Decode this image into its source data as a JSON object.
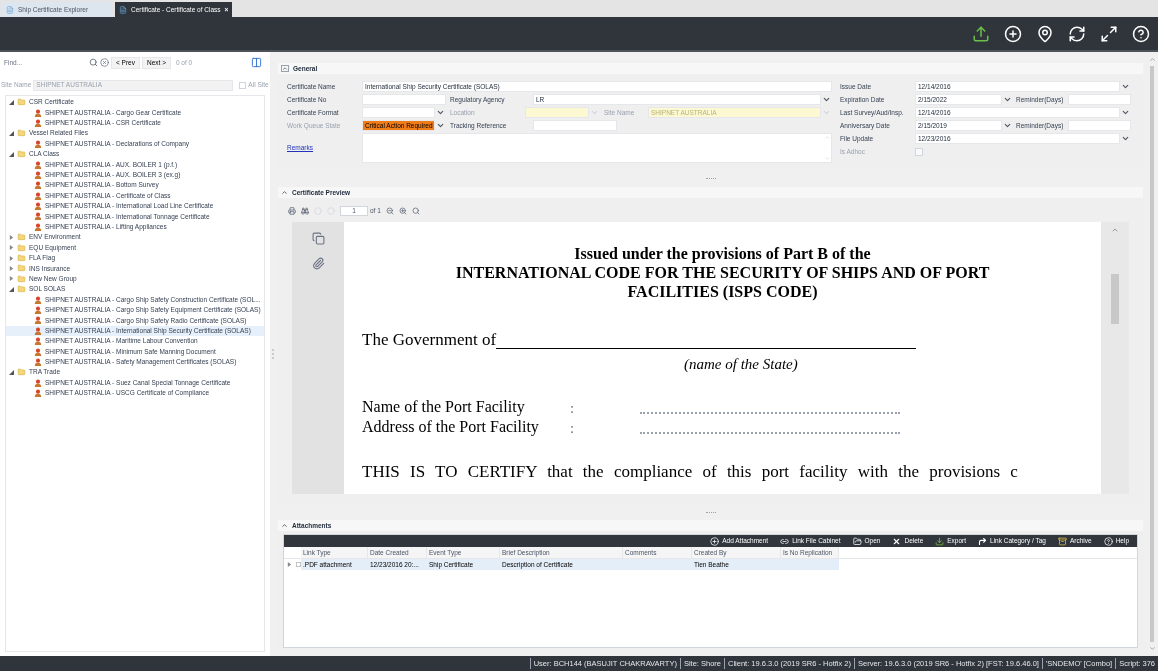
{
  "tabs": [
    {
      "label": "Ship Certificate Explorer",
      "selected": false
    },
    {
      "label": "Certificate - Certificate of Class",
      "selected": true,
      "close": "×"
    }
  ],
  "finder": {
    "placeholder": "Find...",
    "prev": "< Prev",
    "next": "Next >",
    "count": "0 of 0"
  },
  "site": {
    "label": "Site Name",
    "value": "SHIPNET AUSTRALIA",
    "all_label": "All Site",
    "all_checked": false
  },
  "tree": [
    {
      "label": "CSR Certificate",
      "expanded": true,
      "children": [
        {
          "label": "SHIPNET AUSTRALIA - Cargo Gear Certificate",
          "selected": false
        },
        {
          "label": "SHIPNET AUSTRALIA - CSR Certificate",
          "selected": false
        }
      ]
    },
    {
      "label": "Vessel Related Files",
      "expanded": true,
      "children": [
        {
          "label": "SHIPNET AUSTRALIA -  Declarations of Company",
          "selected": false
        }
      ]
    },
    {
      "label": "CLA Class",
      "expanded": true,
      "children": [
        {
          "label": "SHIPNET AUSTRALIA - AUX. BOILER 1 (p.f.)",
          "selected": false
        },
        {
          "label": "SHIPNET AUSTRALIA - AUX. BOILER 3 (ex.g)",
          "selected": false
        },
        {
          "label": "SHIPNET AUSTRALIA - Bottom Survey",
          "selected": false
        },
        {
          "label": "SHIPNET AUSTRALIA - Certificate of Class",
          "selected": false
        },
        {
          "label": "SHIPNET AUSTRALIA - International Load Line Certificate",
          "selected": false
        },
        {
          "label": "SHIPNET AUSTRALIA - International Tonnage Certificate",
          "selected": false
        },
        {
          "label": "SHIPNET AUSTRALIA - Lifting Appliances",
          "selected": false
        }
      ]
    },
    {
      "label": "ENV Environment",
      "expanded": false
    },
    {
      "label": "EQU Equipment",
      "expanded": false
    },
    {
      "label": "FLA Flag",
      "expanded": false
    },
    {
      "label": "INS Insurance",
      "expanded": false
    },
    {
      "label": "New New Group",
      "expanded": false
    },
    {
      "label": "SOL SOLAS",
      "expanded": true,
      "children": [
        {
          "label": "SHIPNET AUSTRALIA - Cargo Ship Safety Construction Certificate (SOL...",
          "selected": false
        },
        {
          "label": "SHIPNET AUSTRALIA - Cargo Ship Safety Equipment Certificate (SOLAS)",
          "selected": false
        },
        {
          "label": "SHIPNET AUSTRALIA - Cargo Ship Safety Radio Certificate (SOLAS)",
          "selected": false
        },
        {
          "label": "SHIPNET AUSTRALIA - International Ship Security Certificate (SOLAS)",
          "selected": true
        },
        {
          "label": "SHIPNET AUSTRALIA - Maritime Labour Convention",
          "selected": false
        },
        {
          "label": "SHIPNET AUSTRALIA - Minimum Safe Manning Document",
          "selected": false
        },
        {
          "label": "SHIPNET AUSTRALIA - Safety Management Certificates (SOLAS)",
          "selected": false
        }
      ]
    },
    {
      "label": "TRA Trade",
      "expanded": true,
      "children": [
        {
          "label": "SHIPNET AUSTRALIA - Suez Canal Special Tonnage Certificate",
          "selected": false
        },
        {
          "label": "SHIPNET AUSTRALIA - USCG Certificate of Compliance",
          "selected": false
        }
      ]
    }
  ],
  "general": {
    "title": "General",
    "left_rows": [
      [
        {
          "kind": "label",
          "text": "Certificate Name",
          "disabled": false
        },
        {
          "kind": "text",
          "value": "International Ship Security Certificate (SOLAS)",
          "disabled": false,
          "alert": false
        }
      ],
      [
        {
          "kind": "label",
          "text": "Certificate No",
          "disabled": false
        },
        {
          "kind": "text",
          "disabled": false,
          "alert": false
        },
        {
          "kind": "label",
          "text": "Regulatory Agency",
          "disabled": false
        },
        {
          "kind": "select",
          "value": "LR",
          "disabled": false,
          "alert": false
        }
      ],
      [
        {
          "kind": "label",
          "text": "Certificate Format",
          "disabled": false
        },
        {
          "kind": "select",
          "disabled": false,
          "alert": false
        },
        {
          "kind": "label",
          "text": "Location",
          "disabled": true
        },
        {
          "kind": "select",
          "disabled": true,
          "alert": false
        },
        {
          "kind": "label",
          "text": "Site Name",
          "disabled": true
        },
        {
          "kind": "select",
          "value": "SHIPNET AUSTRALIA",
          "disabled": true,
          "alert": false
        }
      ],
      [
        {
          "kind": "label",
          "text": "Work Queue State",
          "disabled": true
        },
        {
          "kind": "select",
          "value": "Critical Action Required",
          "disabled": false,
          "alert": true
        },
        {
          "kind": "label",
          "text": "Tracking Reference",
          "disabled": false
        },
        {
          "kind": "text",
          "disabled": false,
          "alert": false
        }
      ],
      [
        {
          "kind": "link",
          "text": "Remarks"
        },
        {
          "kind": "memo",
          "disabled": false,
          "alert": false
        }
      ]
    ],
    "right_rows": [
      [
        {
          "kind": "label",
          "text": "Issue Date",
          "disabled": false
        },
        {
          "kind": "select",
          "value": "12/14/2016",
          "disabled": false,
          "alert": false
        }
      ],
      [
        {
          "kind": "label",
          "text": "Expiration Date",
          "disabled": false
        },
        {
          "kind": "select",
          "value": "2/15/2022",
          "disabled": false,
          "alert": false
        },
        {
          "kind": "label",
          "text": "Reminder(Days)",
          "disabled": false
        },
        {
          "kind": "text",
          "disabled": false,
          "alert": false
        }
      ],
      [
        {
          "kind": "label",
          "text": "Last Survey/Aud/Insp.",
          "disabled": false
        },
        {
          "kind": "select",
          "value": "12/14/2016",
          "disabled": false,
          "alert": false
        }
      ],
      [
        {
          "kind": "label",
          "text": "Anniversary Date",
          "disabled": false
        },
        {
          "kind": "select",
          "value": "2/15/2019",
          "disabled": false,
          "alert": false
        },
        {
          "kind": "label",
          "text": "Reminder(Days)",
          "disabled": false
        },
        {
          "kind": "text",
          "disabled": false,
          "alert": false
        }
      ],
      [
        {
          "kind": "label",
          "text": "File Update",
          "disabled": false
        },
        {
          "kind": "select",
          "value": "12/23/2016",
          "disabled": false,
          "alert": false
        }
      ],
      [
        {
          "kind": "label",
          "text": "Is Adhoc",
          "disabled": true
        },
        {
          "kind": "checkbox",
          "checked": false,
          "disabled": true
        }
      ]
    ]
  },
  "preview": {
    "title": "Certificate Preview",
    "page": "1",
    "page_count": "of 1",
    "document": {
      "heading": [
        "Issued under the provisions of Part B of the",
        "INTERNATIONAL CODE FOR THE SECURITY OF SHIPS AND OF PORT",
        "FACILITIES (ISPS CODE)"
      ],
      "government": "The Government of",
      "state_note": "(name of the State)",
      "fields": [
        {
          "label": "Name of the Port Facility",
          "sep": ":"
        },
        {
          "label": "Address of the Port Facility",
          "sep": ":"
        }
      ],
      "certify": "THIS IS TO CERTIFY that the compliance of this port facility with the provisions c"
    }
  },
  "attachments": {
    "title": "Attachments",
    "actions": [
      {
        "label": "Add Attachment",
        "kind": "add"
      },
      {
        "label": "Link File Cabinet",
        "kind": "link"
      },
      {
        "label": "Open",
        "kind": "open"
      },
      {
        "label": "Delete",
        "kind": "delete"
      },
      {
        "label": "Export",
        "kind": "export"
      },
      {
        "label": "Link Category / Tag",
        "kind": "tag"
      },
      {
        "label": "Archive",
        "kind": "archive"
      },
      {
        "label": "Help",
        "kind": "help"
      }
    ],
    "columns": [
      "Link Type",
      "Date Created",
      "Event Type",
      "Brief Description",
      "Comments",
      "Created By",
      "Is No Replication"
    ],
    "rows": [
      {
        "selected": true,
        "cells": [
          ".PDF attachment",
          "12/23/2016 20:...",
          "Ship Certificate",
          "Description of Certificate",
          "",
          "Tien Beathe",
          ""
        ]
      }
    ]
  },
  "status_bar": [
    "User: BCH144 (BASUJIT CHAKRAVARTY)",
    "Site: Shore",
    "Client: 19.6.3.0 (2019 SR6 - Hotfix 2)",
    "Server: 19.6.3.0 (2019 SR6 - Hotfix 2) [FST: 19.6.46.0]",
    "'SNDEMO' [Combo]",
    "Script: 376"
  ]
}
